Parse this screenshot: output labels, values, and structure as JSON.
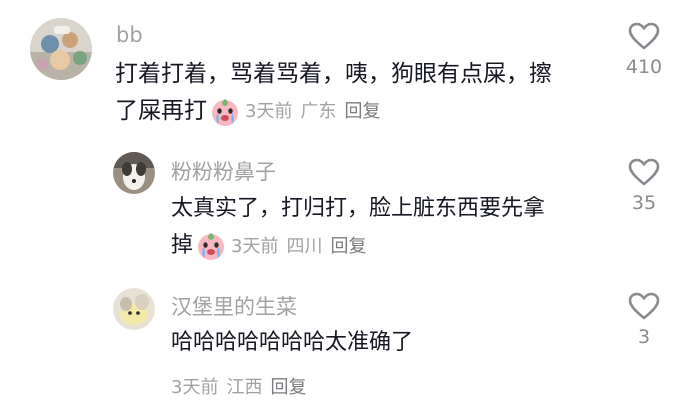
{
  "comments": [
    {
      "username": "bb",
      "text_line1": "打着打着，骂着骂着，咦，狗眼有点屎，擦",
      "text_line2": "了屎再打",
      "time": "3天前",
      "location": "广东",
      "reply": "回复",
      "likes": "410",
      "emoji_icon": "crying-peach-emoji"
    },
    {
      "username": "粉粉粉鼻子",
      "text_line1": "太真实了，打归打，脸上脏东西要先拿",
      "text_line2": "掉",
      "time": "3天前",
      "location": "四川",
      "reply": "回复",
      "likes": "35",
      "emoji_icon": "crying-peach-emoji"
    },
    {
      "username": "汉堡里的生菜",
      "text_line1": "哈哈哈哈哈哈哈太准确了",
      "time": "3天前",
      "location": "江西",
      "reply": "回复",
      "likes": "3"
    }
  ],
  "colors": {
    "text": "#161823",
    "secondary": "#a1a1a6",
    "icon": "#8a8a90"
  }
}
